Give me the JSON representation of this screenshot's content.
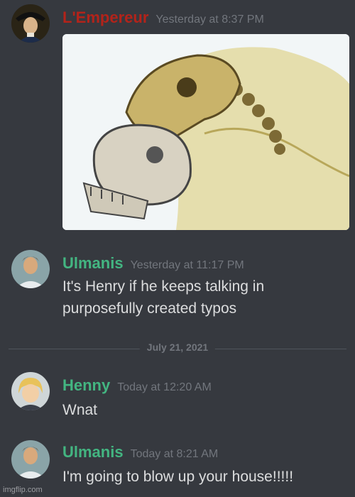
{
  "messages": [
    {
      "username": "L'Empereur",
      "timestamp": "Yesterday at 8:37 PM",
      "color": "#b3231a",
      "text": "",
      "image": "skull-drawing"
    },
    {
      "username": "Ulmanis",
      "timestamp": "Yesterday at 11:17 PM",
      "color": "#43b581",
      "lines": [
        "It's Henry if he keeps talking in",
        "purposefully created typos"
      ]
    },
    {
      "username": "Henny",
      "timestamp": "Today at 12:20 AM",
      "color": "#43b581",
      "text": "Wnat"
    },
    {
      "username": "Ulmanis",
      "timestamp": "Today at 8:21 AM",
      "color": "#43b581",
      "text": "I'm going to blow up your house!!!!!"
    }
  ],
  "divider": {
    "label": "July 21, 2021"
  },
  "watermark": "imgflip.com"
}
